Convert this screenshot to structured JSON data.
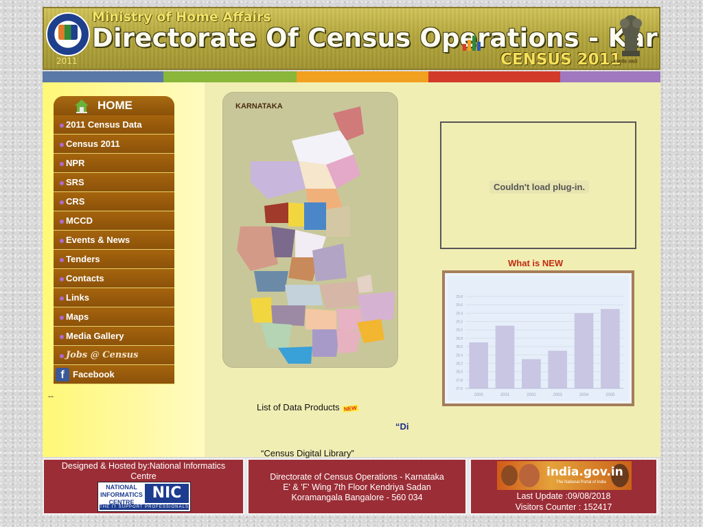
{
  "header": {
    "ministry": "Ministry of Home Affairs",
    "title": "Directorate Of Census Operations - Karnataka",
    "census": "CENSUS 2011",
    "logo_year": "2011",
    "emblem_caption": "सत्यमेव जयते"
  },
  "stripe_colors": [
    "#5a78a8",
    "#8ab63a",
    "#f2a020",
    "#d23a2a",
    "#a078c0"
  ],
  "menu": {
    "home": "HOME",
    "items": [
      {
        "label": "2011 Census Data"
      },
      {
        "label": "Census 2011"
      },
      {
        "label": "NPR"
      },
      {
        "label": "SRS"
      },
      {
        "label": "CRS"
      },
      {
        "label": "MCCD"
      },
      {
        "label": "Events & News"
      },
      {
        "label": "Tenders"
      },
      {
        "label": "Contacts"
      },
      {
        "label": "Links"
      },
      {
        "label": "Maps"
      },
      {
        "label": "Media Gallery"
      },
      {
        "label": "Jobs @ Census"
      },
      {
        "label": "Facebook"
      }
    ]
  },
  "left_dashes": "--",
  "map": {
    "title": "KARNATAKA"
  },
  "plugin_message": "Couldn't load plug-in.",
  "whats_new": "What is NEW",
  "chart_data": {
    "type": "bar",
    "categories": [
      "2000",
      "2001",
      "2002",
      "2003",
      "2004",
      "2005"
    ],
    "values": [
      28.7,
      29.1,
      28.3,
      28.5,
      29.4,
      29.5
    ],
    "ylim": [
      27.6,
      29.8
    ],
    "yticks": [
      "29.8",
      "29.6",
      "29.4",
      "29.2",
      "29.0",
      "28.8",
      "28.6",
      "28.4",
      "28.2",
      "28.0",
      "27.8",
      "27.6"
    ],
    "bar_color": "#c8c6e2"
  },
  "list_data_products": "List of Data Products",
  "new_badge": "NEW",
  "marquee_text": "“Di",
  "census_digital_library": "“Census Digital Library”",
  "footer": {
    "designed": "Designed & Hosted by:National Informatics Centre",
    "nic_left": "NATIONAL INFORMATICS CENTRE",
    "nic_right": "NIC",
    "nic_strip": "THE IT SUPPORT PROFESSIONALS",
    "address_line1": "Directorate of Census Operations - Karnataka",
    "address_line2": "E' & 'F' Wing 7th Floor Kendriya Sadan",
    "address_line3": "Koramangala Bangalore - 560 034",
    "indiagov": "india.gov.in",
    "indiagov_sub": "The National Portal of India",
    "last_update": "Last Update :09/08/2018",
    "visitors": "Visitors Counter : 152417"
  }
}
